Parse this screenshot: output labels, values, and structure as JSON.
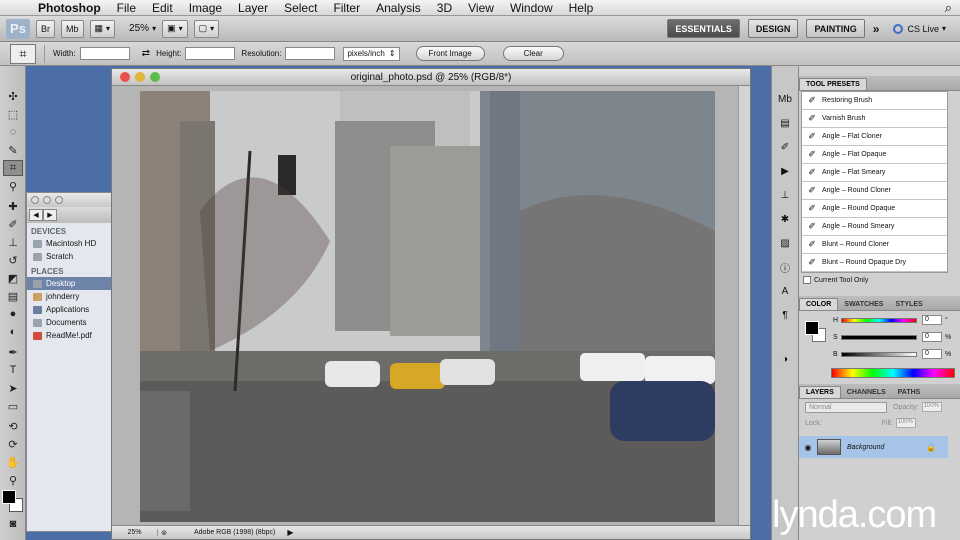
{
  "menubar": {
    "items": [
      "Photoshop",
      "File",
      "Edit",
      "Image",
      "Layer",
      "Select",
      "Filter",
      "Analysis",
      "3D",
      "View",
      "Window",
      "Help"
    ]
  },
  "appbar": {
    "logo": "Ps",
    "btn_bridge": "Br",
    "btn_minibridge": "Mb",
    "zoom": "25%",
    "workspaces": [
      "ESSENTIALS",
      "DESIGN",
      "PAINTING"
    ],
    "more": "»",
    "cslive": "CS Live"
  },
  "options": {
    "width_label": "Width:",
    "height_label": "Height:",
    "resolution_label": "Resolution:",
    "units": "pixels/inch",
    "front_image": "Front Image",
    "clear": "Clear"
  },
  "finder": {
    "devices_header": "DEVICES",
    "devices": [
      "Macintosh HD",
      "Scratch"
    ],
    "places_header": "PLACES",
    "places": [
      "Desktop",
      "johnderry",
      "Applications",
      "Documents",
      "ReadMe!.pdf"
    ]
  },
  "document": {
    "title": "original_photo.psd @ 25% (RGB/8*)",
    "status_zoom": "25%",
    "status_profile": "Adobe RGB (1998) (8bpc)"
  },
  "presets": {
    "tab": "TOOL PRESETS",
    "items": [
      "Restoring Brush",
      "Varnish Brush",
      "Angle – Flat Cloner",
      "Angle – Flat Opaque",
      "Angle – Flat Smeary",
      "Angle – Round Cloner",
      "Angle – Round Opaque",
      "Angle – Round Smeary",
      "Blunt – Round Cloner",
      "Blunt – Round Opaque Dry"
    ],
    "current_tool_only": "Current Tool Only"
  },
  "color": {
    "tabs": [
      "COLOR",
      "SWATCHES",
      "STYLES"
    ],
    "channels": [
      {
        "label": "H",
        "value": "0",
        "unit": "°"
      },
      {
        "label": "S",
        "value": "0",
        "unit": "%"
      },
      {
        "label": "B",
        "value": "0",
        "unit": "%"
      }
    ]
  },
  "layers": {
    "tabs": [
      "LAYERS",
      "CHANNELS",
      "PATHS"
    ],
    "blend_mode": "Normal",
    "opacity_label": "Opacity:",
    "opacity": "100%",
    "lock_label": "Lock:",
    "fill_label": "Fill:",
    "fill": "100%",
    "layer_name": "Background"
  },
  "watermark": "lynda.com"
}
